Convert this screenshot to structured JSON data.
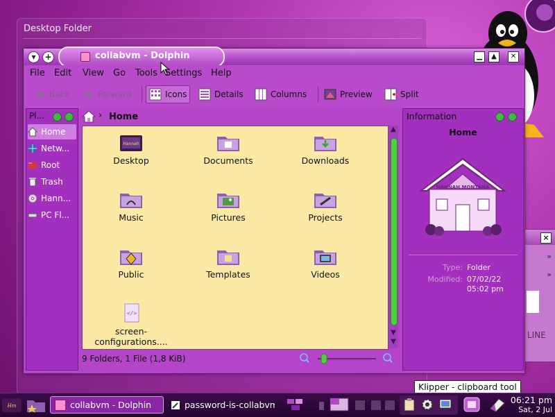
{
  "desktop": {
    "folder_widget_title": "Desktop Folder",
    "side_window_text": "LINE"
  },
  "window": {
    "title": "collabvm - Dolphin",
    "menu": [
      "File",
      "Edit",
      "View",
      "Go",
      "Tools",
      "Settings",
      "Help"
    ],
    "toolbar": {
      "back": "Back",
      "forward": "Forward",
      "icons": "Icons",
      "details": "Details",
      "columns": "Columns",
      "preview": "Preview",
      "split": "Split"
    },
    "places": {
      "header": "Pl...",
      "items": [
        {
          "label": "Home",
          "icon": "home-icon",
          "selected": true
        },
        {
          "label": "Netw...",
          "icon": "network-icon",
          "selected": false
        },
        {
          "label": "Root",
          "icon": "root-icon",
          "selected": false
        },
        {
          "label": "Trash",
          "icon": "trash-icon",
          "selected": false
        },
        {
          "label": "Hann...",
          "icon": "disc-icon",
          "selected": false
        },
        {
          "label": "PC Fl...",
          "icon": "floppy-icon",
          "selected": false
        }
      ]
    },
    "breadcrumb": {
      "current": "Home"
    },
    "files": [
      {
        "label": "Desktop",
        "icon": "desktop-folder-icon"
      },
      {
        "label": "Documents",
        "icon": "documents-folder-icon"
      },
      {
        "label": "Downloads",
        "icon": "downloads-folder-icon"
      },
      {
        "label": "Music",
        "icon": "music-folder-icon"
      },
      {
        "label": "Pictures",
        "icon": "pictures-folder-icon"
      },
      {
        "label": "Projects",
        "icon": "projects-folder-icon"
      },
      {
        "label": "Public",
        "icon": "public-folder-icon"
      },
      {
        "label": "Templates",
        "icon": "templates-folder-icon"
      },
      {
        "label": "Videos",
        "icon": "videos-folder-icon"
      },
      {
        "label": "screen-configurations....",
        "icon": "xml-file-icon"
      }
    ],
    "status": "9 Folders, 1 File (1,8 KiB)",
    "information": {
      "header": "Information",
      "name": "Home",
      "house_sign": "HANNAH MONTANA",
      "type_label": "Type:",
      "type_value": "Folder",
      "modified_label": "Modified:",
      "modified_date": "07/02/22",
      "modified_time": "05:02 pm"
    }
  },
  "taskbar": {
    "tasks": [
      {
        "label": "collabvm - Dolphin",
        "active": true
      },
      {
        "label": "password-is-collabvm",
        "active": false
      }
    ],
    "clock_time": "06:21 pm",
    "clock_date": "Sat, 2 Jul",
    "tooltip": "Klipper - clipboard tool"
  },
  "colors": {
    "window_bg": "#b445c9",
    "view_bg": "#fbe9a5",
    "scroll_thumb": "#4ed040",
    "taskbar": "#2d0839"
  }
}
